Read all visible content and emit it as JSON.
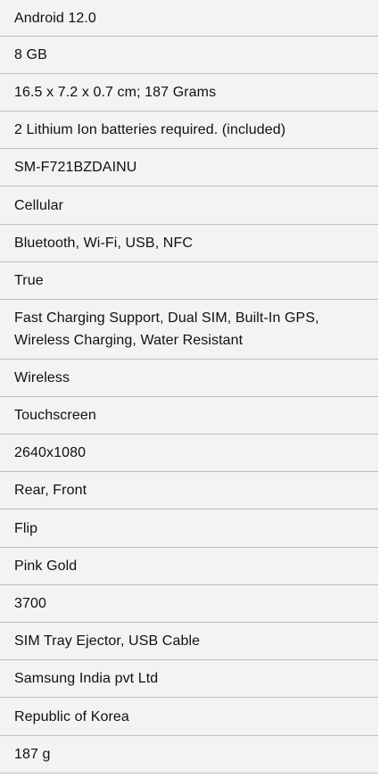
{
  "specs": [
    {
      "value": "Android 12.0"
    },
    {
      "value": "8 GB"
    },
    {
      "value": "16.5 x 7.2 x 0.7 cm; 187 Grams"
    },
    {
      "value": "2 Lithium Ion batteries required. (included)"
    },
    {
      "value": "SM-F721BZDAINU"
    },
    {
      "value": "Cellular"
    },
    {
      "value": "Bluetooth, Wi-Fi, USB, NFC"
    },
    {
      "value": "True"
    },
    {
      "value": "Fast Charging Support, Dual SIM, Built-In GPS, Wireless Charging, Water Resistant"
    },
    {
      "value": "Wireless"
    },
    {
      "value": "Touchscreen"
    },
    {
      "value": "2640x1080"
    },
    {
      "value": "Rear, Front"
    },
    {
      "value": "Flip"
    },
    {
      "value": "Pink Gold"
    },
    {
      "value": "3700"
    },
    {
      "value": "SIM Tray Ejector, USB Cable"
    },
    {
      "value": "Samsung India pvt Ltd"
    },
    {
      "value": "Republic of Korea"
    },
    {
      "value": "187 g"
    }
  ]
}
